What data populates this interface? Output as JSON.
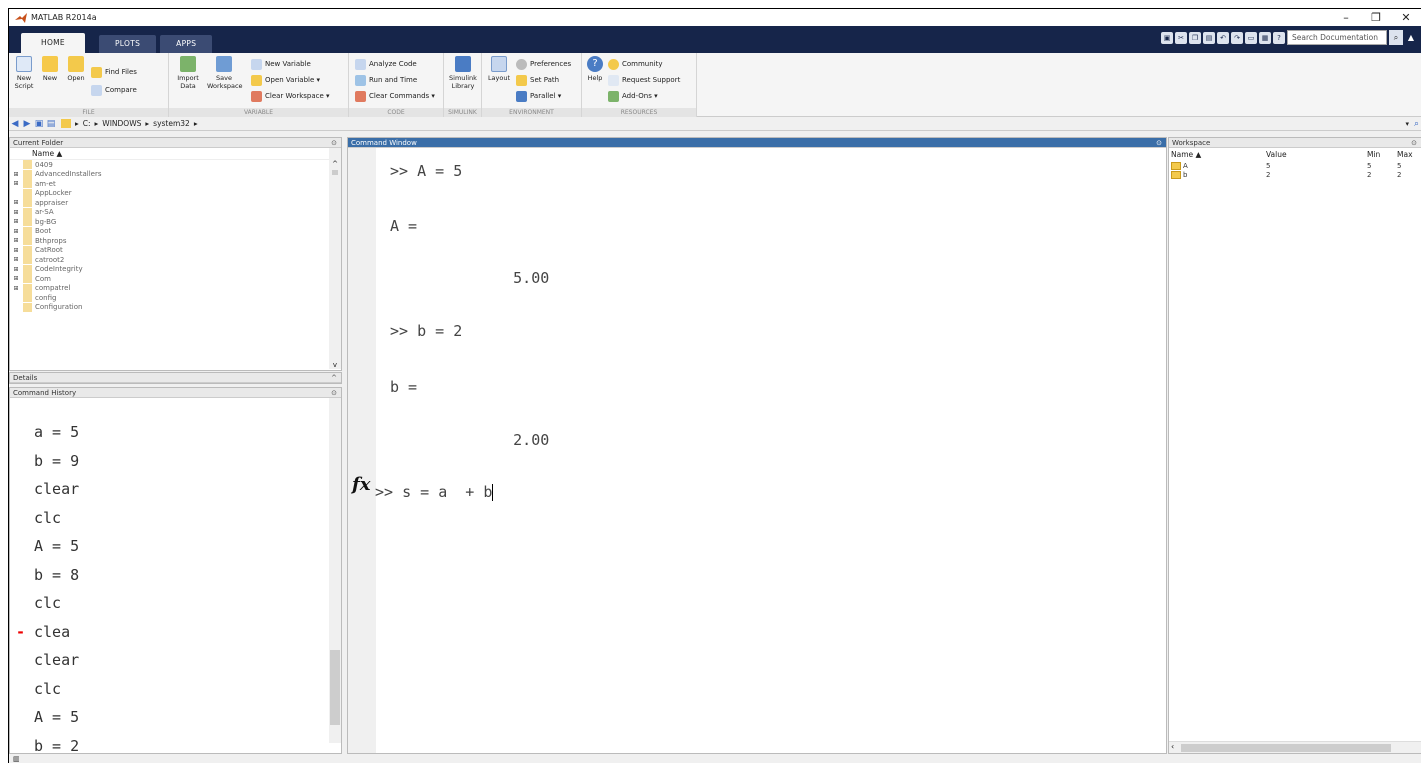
{
  "window": {
    "title": "MATLAB R2014a",
    "minimize": "–",
    "maximize": "❐",
    "close": "✕"
  },
  "tabs": [
    {
      "label": "HOME"
    },
    {
      "label": "PLOTS"
    },
    {
      "label": "APPS"
    }
  ],
  "quickbar": {
    "search_placeholder": "Search Documentation"
  },
  "ribbon": {
    "file": {
      "label": "FILE",
      "new_script": "New\nScript",
      "new": "New",
      "open": "Open",
      "find_files": "Find Files",
      "compare": "Compare"
    },
    "variable": {
      "label": "VARIABLE",
      "import_data": "Import\nData",
      "save_workspace": "Save\nWorkspace",
      "new_variable": "New Variable",
      "open_variable": "Open Variable ▾",
      "clear_workspace": "Clear Workspace ▾"
    },
    "code": {
      "label": "CODE",
      "analyze_code": "Analyze Code",
      "run_and_time": "Run and Time",
      "clear_commands": "Clear Commands ▾"
    },
    "simulink": {
      "label": "SIMULINK",
      "library": "Simulink\nLibrary"
    },
    "environment": {
      "label": "ENVIRONMENT",
      "layout": "Layout",
      "preferences": "Preferences",
      "set_path": "Set Path",
      "parallel": "Parallel ▾"
    },
    "resources": {
      "label": "RESOURCES",
      "help": "Help",
      "community": "Community",
      "request_support": "Request Support",
      "add_ons": "Add-Ons ▾"
    }
  },
  "address": {
    "segments": [
      "C:",
      "WINDOWS",
      "system32"
    ]
  },
  "current_folder": {
    "title": "Current Folder",
    "column": "Name ▲",
    "items": [
      {
        "name": "0409",
        "exp": ""
      },
      {
        "name": "AdvancedInstallers",
        "exp": "⊞"
      },
      {
        "name": "am-et",
        "exp": "⊞"
      },
      {
        "name": "AppLocker",
        "exp": ""
      },
      {
        "name": "appraiser",
        "exp": "⊞"
      },
      {
        "name": "ar-SA",
        "exp": "⊞"
      },
      {
        "name": "bg-BG",
        "exp": "⊞"
      },
      {
        "name": "Boot",
        "exp": "⊞"
      },
      {
        "name": "Bthprops",
        "exp": "⊞"
      },
      {
        "name": "CatRoot",
        "exp": "⊞"
      },
      {
        "name": "catroot2",
        "exp": "⊞"
      },
      {
        "name": "CodeIntegrity",
        "exp": "⊞"
      },
      {
        "name": "Com",
        "exp": "⊞"
      },
      {
        "name": "compatrel",
        "exp": "⊞"
      },
      {
        "name": "config",
        "exp": ""
      },
      {
        "name": "Configuration",
        "exp": ""
      }
    ]
  },
  "details": {
    "title": "Details"
  },
  "command_history": {
    "title": "Command History",
    "items": [
      {
        "text": "a = 5",
        "mark": ""
      },
      {
        "text": "b = 9",
        "mark": ""
      },
      {
        "text": "clear",
        "mark": ""
      },
      {
        "text": "clc",
        "mark": ""
      },
      {
        "text": "A = 5",
        "mark": ""
      },
      {
        "text": "b = 8",
        "mark": ""
      },
      {
        "text": "clc",
        "mark": ""
      },
      {
        "text": "clea",
        "mark": "-"
      },
      {
        "text": "clear",
        "mark": ""
      },
      {
        "text": "clc",
        "mark": ""
      },
      {
        "text": "A = 5",
        "mark": ""
      },
      {
        "text": "b = 2",
        "mark": ""
      }
    ]
  },
  "command_window": {
    "title": "Command Window",
    "lines": [
      ">> A = 5",
      "A =",
      "     5.00",
      ">> b = 2",
      "b =",
      "     2.00"
    ],
    "fx": "fx",
    "prompt": ">> s = a  + b"
  },
  "workspace": {
    "title": "Workspace",
    "columns": [
      "Name ▲",
      "Value",
      "Min",
      "Max"
    ],
    "rows": [
      {
        "name": "A",
        "value": "5",
        "min": "5",
        "max": "5"
      },
      {
        "name": "b",
        "value": "2",
        "min": "2",
        "max": "2"
      }
    ]
  },
  "colors": {
    "accent": "#3a6ea8",
    "tabstrip": "#16254a"
  }
}
